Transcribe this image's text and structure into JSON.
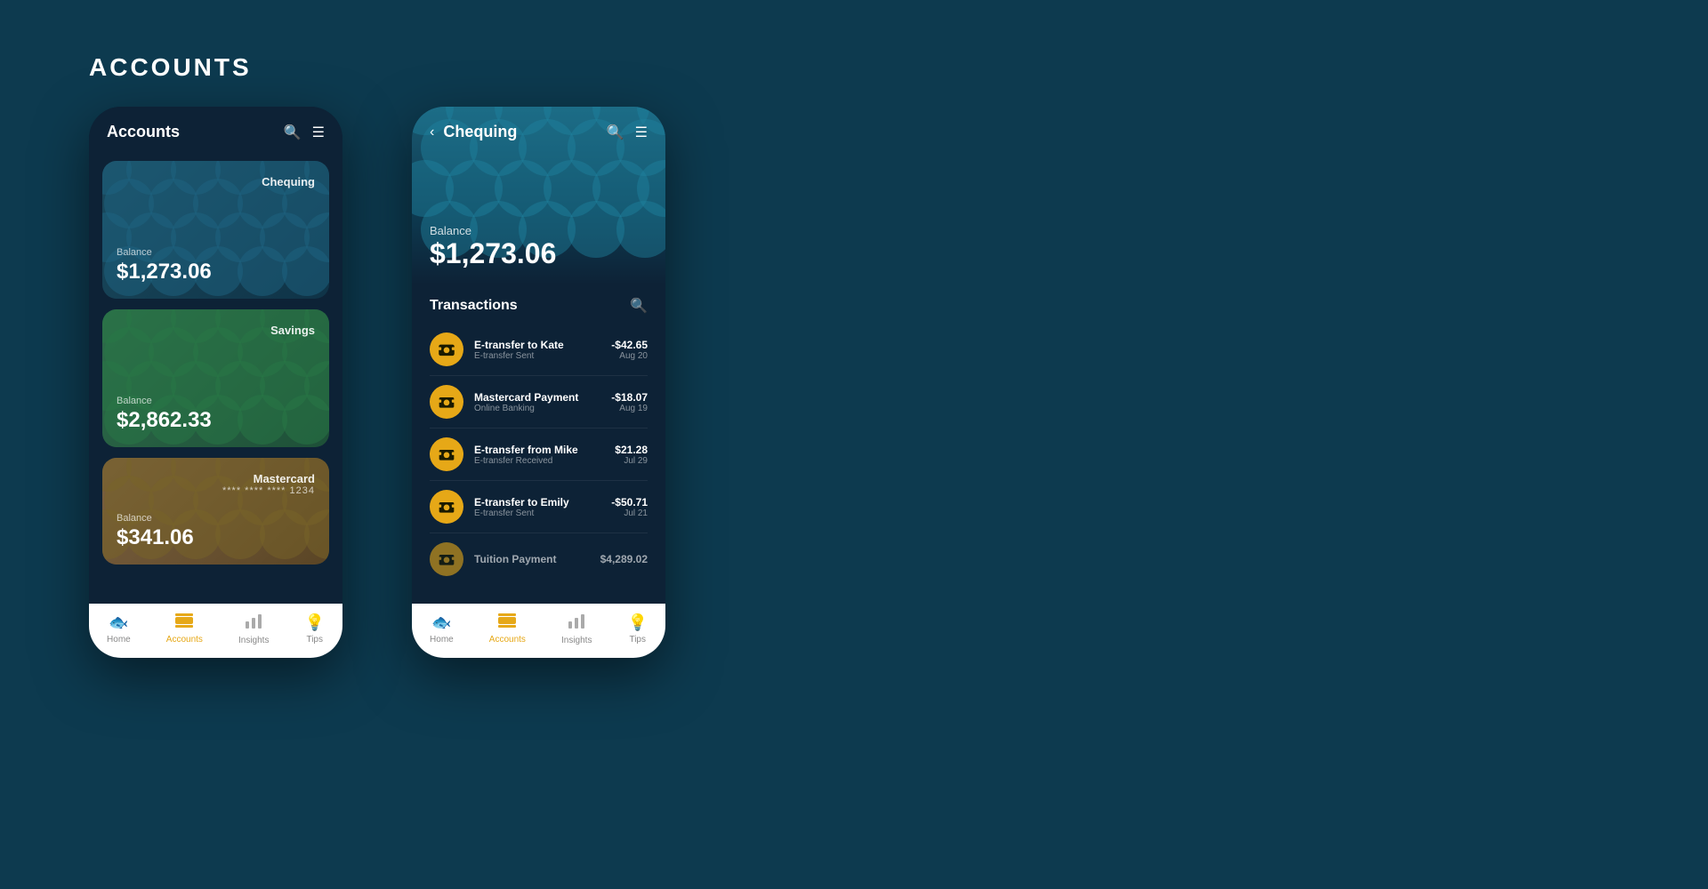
{
  "page": {
    "title": "ACCOUNTS",
    "bg_color": "#0d3a4f"
  },
  "phone_left": {
    "header": {
      "title": "Accounts"
    },
    "cards": [
      {
        "type": "Chequing",
        "balance_label": "Balance",
        "balance": "$1,273.06",
        "card_color": "chequing"
      },
      {
        "type": "Savings",
        "balance_label": "Balance",
        "balance": "$2,862.33",
        "card_color": "savings"
      },
      {
        "type": "Mastercard",
        "card_number": "**** **** **** 1234",
        "balance_label": "Balance",
        "balance": "$341.06",
        "card_color": "mastercard"
      }
    ],
    "nav": {
      "items": [
        {
          "label": "Home",
          "icon": "🐟",
          "active": false
        },
        {
          "label": "Accounts",
          "icon": "💳",
          "active": true
        },
        {
          "label": "Insights",
          "icon": "📊",
          "active": false
        },
        {
          "label": "Tips",
          "icon": "💡",
          "active": false
        }
      ]
    }
  },
  "phone_right": {
    "header": {
      "back_label": "‹",
      "title": "Chequing"
    },
    "hero": {
      "balance_label": "Balance",
      "balance": "$1,273.06"
    },
    "transactions": {
      "title": "Transactions",
      "items": [
        {
          "name": "E-transfer to Kate",
          "sub": "E-transfer Sent",
          "amount": "-$42.65",
          "date": "Aug 20"
        },
        {
          "name": "Mastercard Payment",
          "sub": "Online Banking",
          "amount": "-$18.07",
          "date": "Aug 19"
        },
        {
          "name": "E-transfer from Mike",
          "sub": "E-transfer Received",
          "amount": "$21.28",
          "date": "Jul 29"
        },
        {
          "name": "E-transfer to Emily",
          "sub": "E-transfer Sent",
          "amount": "-$50.71",
          "date": "Jul 21"
        },
        {
          "name": "Tuition Payment",
          "sub": "",
          "amount": "$4,289.02",
          "date": ""
        }
      ]
    },
    "nav": {
      "items": [
        {
          "label": "Home",
          "icon": "🐟",
          "active": false
        },
        {
          "label": "Accounts",
          "icon": "💳",
          "active": true
        },
        {
          "label": "Insights",
          "icon": "📊",
          "active": false
        },
        {
          "label": "Tips",
          "icon": "💡",
          "active": false
        }
      ]
    }
  }
}
